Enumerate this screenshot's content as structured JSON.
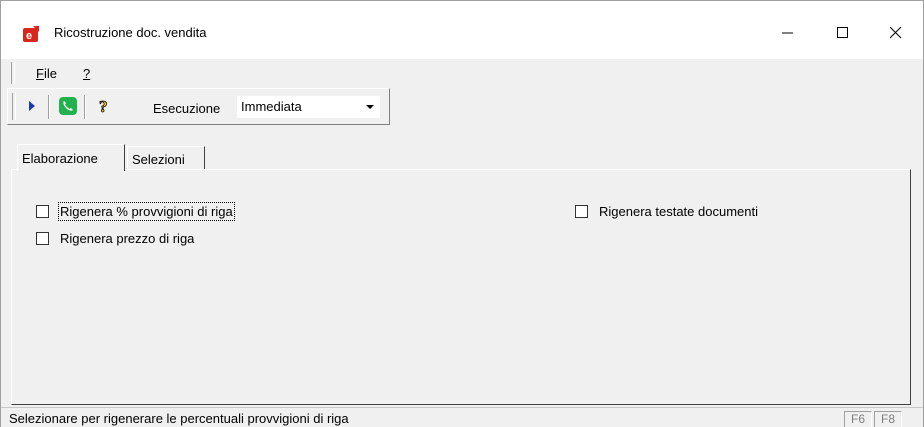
{
  "window": {
    "title": "Ricostruzione doc. vendita",
    "icon": "app-e-icon"
  },
  "menu": {
    "file_label": "File",
    "file_mnemonic": "F",
    "file_rest": "ile",
    "help_label": "?"
  },
  "toolbar": {
    "run_icon": "play-arrow-icon",
    "phone_icon": "green-phone-icon",
    "help_icon": "question-mark-icon",
    "execution_label": "Esecuzione",
    "execution_value": "Immediata"
  },
  "tabs": [
    {
      "label": "Elaborazione",
      "active": true
    },
    {
      "label": "Selezioni",
      "active": false
    }
  ],
  "options": {
    "left": [
      {
        "label": "Rigenera % provvigioni di riga",
        "checked": false,
        "focused": true
      },
      {
        "label": "Rigenera prezzo di riga",
        "checked": false
      }
    ],
    "right": [
      {
        "label": "Rigenera testate documenti",
        "checked": false
      }
    ]
  },
  "status": {
    "text": "Selezionare per rigenerare le percentuali provvigioni di riga",
    "key_f6": "F6",
    "key_f8": "F8"
  },
  "colors": {
    "app_icon_red": "#d9261c",
    "phone_green": "#22b14c",
    "play_blue": "#1a3aa8",
    "help_yellow": "#f2d21b"
  }
}
